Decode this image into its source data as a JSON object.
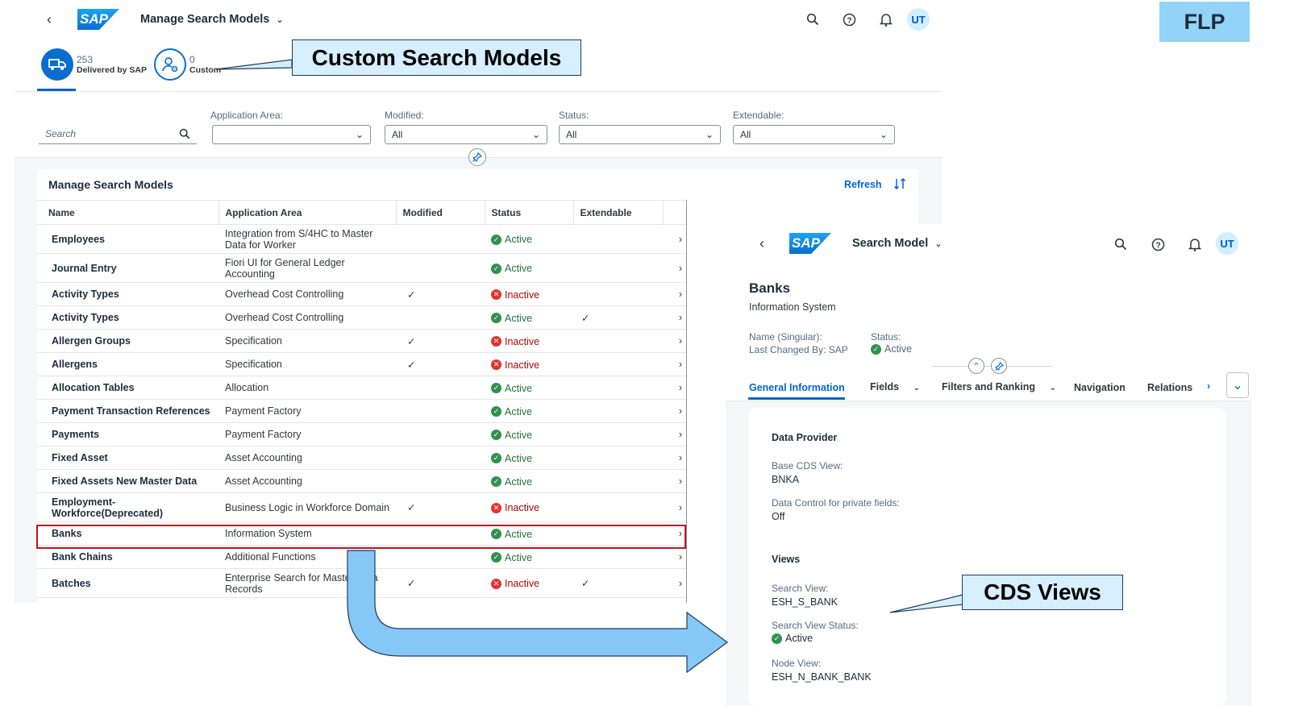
{
  "left": {
    "shell_title": "Manage Search Models",
    "avatar": "UT",
    "kpi": [
      {
        "count": "253",
        "label": "Delivered by SAP"
      },
      {
        "count": "0",
        "label": "Custom"
      }
    ],
    "filters": {
      "search_placeholder": "Search",
      "application_area": {
        "label": "Application Area:",
        "value": ""
      },
      "modified": {
        "label": "Modified:",
        "value": "All"
      },
      "status": {
        "label": "Status:",
        "value": "All"
      },
      "extendable": {
        "label": "Extendable:",
        "value": "All"
      }
    },
    "table": {
      "title": "Manage Search Models",
      "refresh": "Refresh",
      "columns": [
        "Name",
        "Application Area",
        "Modified",
        "Status",
        "Extendable"
      ],
      "rows": [
        {
          "name": "Employees",
          "area": "Integration from S/4HC to Master Data for Worker",
          "modified": false,
          "status": "Active",
          "extendable": false
        },
        {
          "name": "Journal Entry",
          "area": "Fiori UI for General Ledger Accounting",
          "modified": false,
          "status": "Active",
          "extendable": false
        },
        {
          "name": "Activity Types",
          "area": "Overhead Cost Controlling",
          "modified": true,
          "status": "Inactive",
          "extendable": false
        },
        {
          "name": "Activity Types",
          "area": "Overhead Cost Controlling",
          "modified": false,
          "status": "Active",
          "extendable": true
        },
        {
          "name": "Allergen Groups",
          "area": "Specification",
          "modified": true,
          "status": "Inactive",
          "extendable": false
        },
        {
          "name": "Allergens",
          "area": "Specification",
          "modified": true,
          "status": "Inactive",
          "extendable": false
        },
        {
          "name": "Allocation Tables",
          "area": "Allocation",
          "modified": false,
          "status": "Active",
          "extendable": false
        },
        {
          "name": "Payment Transaction References",
          "area": "Payment Factory",
          "modified": false,
          "status": "Active",
          "extendable": false
        },
        {
          "name": "Payments",
          "area": "Payment Factory",
          "modified": false,
          "status": "Active",
          "extendable": false
        },
        {
          "name": "Fixed Asset",
          "area": "Asset Accounting",
          "modified": false,
          "status": "Active",
          "extendable": false
        },
        {
          "name": "Fixed Assets New Master Data",
          "area": "Asset Accounting",
          "modified": false,
          "status": "Active",
          "extendable": false
        },
        {
          "name": "Employment-Workforce(Deprecated)",
          "area": "Business Logic in Workforce Domain",
          "modified": true,
          "status": "Inactive",
          "extendable": false
        },
        {
          "name": "Banks",
          "area": "Information System",
          "modified": false,
          "status": "Active",
          "extendable": false
        },
        {
          "name": "Bank Chains",
          "area": "Additional Functions",
          "modified": false,
          "status": "Active",
          "extendable": false
        },
        {
          "name": "Batches",
          "area": "Enterprise Search for Master Data Records",
          "modified": true,
          "status": "Inactive",
          "extendable": true
        }
      ]
    }
  },
  "right": {
    "shell_title": "Search Model",
    "avatar": "UT",
    "object_title": "Banks",
    "object_subtitle": "Information System",
    "name_singular_label": "Name (Singular):",
    "last_changed_label": "Last Changed By: SAP",
    "status_label": "Status:",
    "status_value": "Active",
    "tabs": [
      "General Information",
      "Fields",
      "Filters and Ranking",
      "Navigation",
      "Relations"
    ],
    "data_provider": {
      "title": "Data Provider",
      "base_cds_label": "Base CDS View:",
      "base_cds_value": "BNKA",
      "data_control_label": "Data Control for private fields:",
      "data_control_value": "Off"
    },
    "views": {
      "title": "Views",
      "search_view_label": "Search View:",
      "search_view_value": "ESH_S_BANK",
      "search_view_status_label": "Search View Status:",
      "search_view_status_value": "Active",
      "node_view_label": "Node View:",
      "node_view_value": "ESH_N_BANK_BANK"
    }
  },
  "callouts": {
    "custom_search_models": "Custom Search Models",
    "cds_views": "CDS Views",
    "flp": "FLP"
  },
  "colors": {
    "accent": "#0064d9",
    "active": "#30914c",
    "inactive": "#e0342f",
    "callout_fill": "#d6efff",
    "flp_fill": "#92d3f7",
    "arrow_fill": "#86c8f5",
    "highlight": "#c0151e"
  }
}
